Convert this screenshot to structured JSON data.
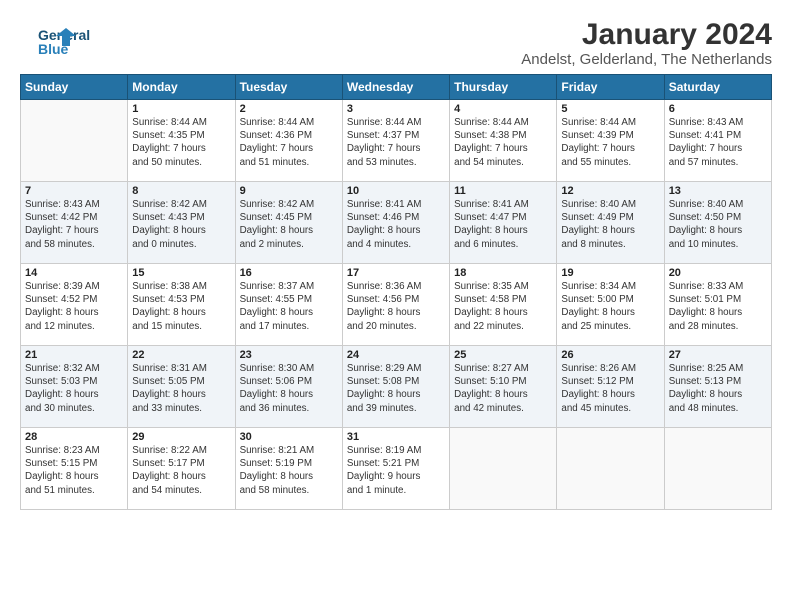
{
  "header": {
    "logo_line1": "General",
    "logo_line2": "Blue",
    "title": "January 2024",
    "subtitle": "Andelst, Gelderland, The Netherlands"
  },
  "days_of_week": [
    "Sunday",
    "Monday",
    "Tuesday",
    "Wednesday",
    "Thursday",
    "Friday",
    "Saturday"
  ],
  "weeks": [
    [
      {
        "date": "",
        "info": ""
      },
      {
        "date": "1",
        "info": "Sunrise: 8:44 AM\nSunset: 4:35 PM\nDaylight: 7 hours\nand 50 minutes."
      },
      {
        "date": "2",
        "info": "Sunrise: 8:44 AM\nSunset: 4:36 PM\nDaylight: 7 hours\nand 51 minutes."
      },
      {
        "date": "3",
        "info": "Sunrise: 8:44 AM\nSunset: 4:37 PM\nDaylight: 7 hours\nand 53 minutes."
      },
      {
        "date": "4",
        "info": "Sunrise: 8:44 AM\nSunset: 4:38 PM\nDaylight: 7 hours\nand 54 minutes."
      },
      {
        "date": "5",
        "info": "Sunrise: 8:44 AM\nSunset: 4:39 PM\nDaylight: 7 hours\nand 55 minutes."
      },
      {
        "date": "6",
        "info": "Sunrise: 8:43 AM\nSunset: 4:41 PM\nDaylight: 7 hours\nand 57 minutes."
      }
    ],
    [
      {
        "date": "7",
        "info": "Sunrise: 8:43 AM\nSunset: 4:42 PM\nDaylight: 7 hours\nand 58 minutes."
      },
      {
        "date": "8",
        "info": "Sunrise: 8:42 AM\nSunset: 4:43 PM\nDaylight: 8 hours\nand 0 minutes."
      },
      {
        "date": "9",
        "info": "Sunrise: 8:42 AM\nSunset: 4:45 PM\nDaylight: 8 hours\nand 2 minutes."
      },
      {
        "date": "10",
        "info": "Sunrise: 8:41 AM\nSunset: 4:46 PM\nDaylight: 8 hours\nand 4 minutes."
      },
      {
        "date": "11",
        "info": "Sunrise: 8:41 AM\nSunset: 4:47 PM\nDaylight: 8 hours\nand 6 minutes."
      },
      {
        "date": "12",
        "info": "Sunrise: 8:40 AM\nSunset: 4:49 PM\nDaylight: 8 hours\nand 8 minutes."
      },
      {
        "date": "13",
        "info": "Sunrise: 8:40 AM\nSunset: 4:50 PM\nDaylight: 8 hours\nand 10 minutes."
      }
    ],
    [
      {
        "date": "14",
        "info": "Sunrise: 8:39 AM\nSunset: 4:52 PM\nDaylight: 8 hours\nand 12 minutes."
      },
      {
        "date": "15",
        "info": "Sunrise: 8:38 AM\nSunset: 4:53 PM\nDaylight: 8 hours\nand 15 minutes."
      },
      {
        "date": "16",
        "info": "Sunrise: 8:37 AM\nSunset: 4:55 PM\nDaylight: 8 hours\nand 17 minutes."
      },
      {
        "date": "17",
        "info": "Sunrise: 8:36 AM\nSunset: 4:56 PM\nDaylight: 8 hours\nand 20 minutes."
      },
      {
        "date": "18",
        "info": "Sunrise: 8:35 AM\nSunset: 4:58 PM\nDaylight: 8 hours\nand 22 minutes."
      },
      {
        "date": "19",
        "info": "Sunrise: 8:34 AM\nSunset: 5:00 PM\nDaylight: 8 hours\nand 25 minutes."
      },
      {
        "date": "20",
        "info": "Sunrise: 8:33 AM\nSunset: 5:01 PM\nDaylight: 8 hours\nand 28 minutes."
      }
    ],
    [
      {
        "date": "21",
        "info": "Sunrise: 8:32 AM\nSunset: 5:03 PM\nDaylight: 8 hours\nand 30 minutes."
      },
      {
        "date": "22",
        "info": "Sunrise: 8:31 AM\nSunset: 5:05 PM\nDaylight: 8 hours\nand 33 minutes."
      },
      {
        "date": "23",
        "info": "Sunrise: 8:30 AM\nSunset: 5:06 PM\nDaylight: 8 hours\nand 36 minutes."
      },
      {
        "date": "24",
        "info": "Sunrise: 8:29 AM\nSunset: 5:08 PM\nDaylight: 8 hours\nand 39 minutes."
      },
      {
        "date": "25",
        "info": "Sunrise: 8:27 AM\nSunset: 5:10 PM\nDaylight: 8 hours\nand 42 minutes."
      },
      {
        "date": "26",
        "info": "Sunrise: 8:26 AM\nSunset: 5:12 PM\nDaylight: 8 hours\nand 45 minutes."
      },
      {
        "date": "27",
        "info": "Sunrise: 8:25 AM\nSunset: 5:13 PM\nDaylight: 8 hours\nand 48 minutes."
      }
    ],
    [
      {
        "date": "28",
        "info": "Sunrise: 8:23 AM\nSunset: 5:15 PM\nDaylight: 8 hours\nand 51 minutes."
      },
      {
        "date": "29",
        "info": "Sunrise: 8:22 AM\nSunset: 5:17 PM\nDaylight: 8 hours\nand 54 minutes."
      },
      {
        "date": "30",
        "info": "Sunrise: 8:21 AM\nSunset: 5:19 PM\nDaylight: 8 hours\nand 58 minutes."
      },
      {
        "date": "31",
        "info": "Sunrise: 8:19 AM\nSunset: 5:21 PM\nDaylight: 9 hours\nand 1 minute."
      },
      {
        "date": "",
        "info": ""
      },
      {
        "date": "",
        "info": ""
      },
      {
        "date": "",
        "info": ""
      }
    ]
  ]
}
